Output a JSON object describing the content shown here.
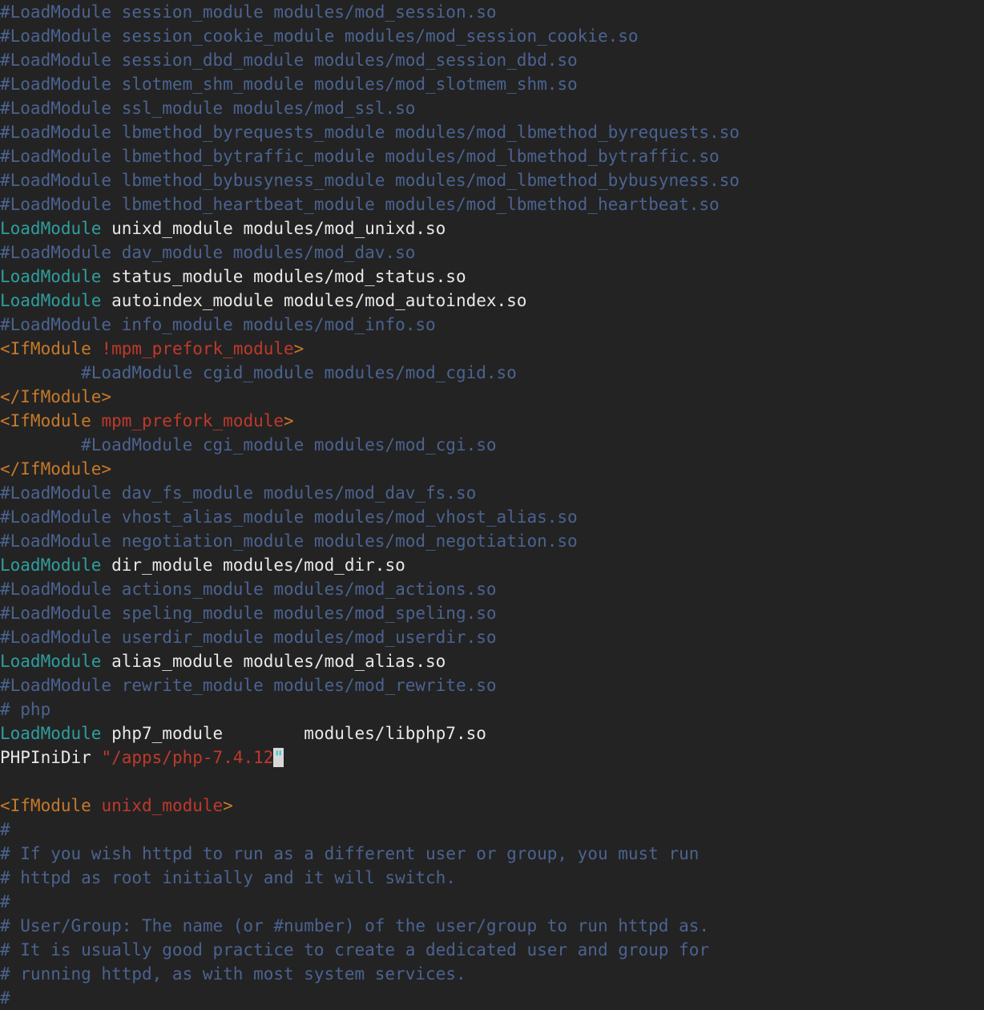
{
  "app": {
    "name": "text-editor",
    "file_type": "apache-httpd-config",
    "background_color": "#232323"
  },
  "colors": {
    "background": "#232323",
    "comment": "#4b6391",
    "directive": "#2f9e9e",
    "argument": "#e8e8e8",
    "tag": "#c8792a",
    "tag_argument": "#c0392b",
    "string": "#c0392b",
    "cursor_background": "#d8d8d8",
    "cursor_foreground": "#25c4d4"
  },
  "cursor": {
    "line_index": 30,
    "character": "\"",
    "column": 28
  },
  "lines": [
    {
      "tokens": [
        {
          "t": "#LoadModule session_module modules/mod_session.so",
          "c": "comment"
        }
      ]
    },
    {
      "tokens": [
        {
          "t": "#LoadModule session_cookie_module modules/mod_session_cookie.so",
          "c": "comment"
        }
      ]
    },
    {
      "tokens": [
        {
          "t": "#LoadModule session_dbd_module modules/mod_session_dbd.so",
          "c": "comment"
        }
      ]
    },
    {
      "tokens": [
        {
          "t": "#LoadModule slotmem_shm_module modules/mod_slotmem_shm.so",
          "c": "comment"
        }
      ]
    },
    {
      "tokens": [
        {
          "t": "#LoadModule ssl_module modules/mod_ssl.so",
          "c": "comment"
        }
      ]
    },
    {
      "tokens": [
        {
          "t": "#LoadModule lbmethod_byrequests_module modules/mod_lbmethod_byrequests.so",
          "c": "comment"
        }
      ]
    },
    {
      "tokens": [
        {
          "t": "#LoadModule lbmethod_bytraffic_module modules/mod_lbmethod_bytraffic.so",
          "c": "comment"
        }
      ]
    },
    {
      "tokens": [
        {
          "t": "#LoadModule lbmethod_bybusyness_module modules/mod_lbmethod_bybusyness.so",
          "c": "comment"
        }
      ]
    },
    {
      "tokens": [
        {
          "t": "#LoadModule lbmethod_heartbeat_module modules/mod_lbmethod_heartbeat.so",
          "c": "comment"
        }
      ]
    },
    {
      "tokens": [
        {
          "t": "LoadModule",
          "c": "directive"
        },
        {
          "t": " unixd_module modules/mod_unixd.so",
          "c": "arg"
        }
      ]
    },
    {
      "tokens": [
        {
          "t": "#LoadModule dav_module modules/mod_dav.so",
          "c": "comment"
        }
      ]
    },
    {
      "tokens": [
        {
          "t": "LoadModule",
          "c": "directive"
        },
        {
          "t": " status_module modules/mod_status.so",
          "c": "arg"
        }
      ]
    },
    {
      "tokens": [
        {
          "t": "LoadModule",
          "c": "directive"
        },
        {
          "t": " autoindex_module modules/mod_autoindex.so",
          "c": "arg"
        }
      ]
    },
    {
      "tokens": [
        {
          "t": "#LoadModule info_module modules/mod_info.so",
          "c": "comment"
        }
      ]
    },
    {
      "tokens": [
        {
          "t": "<IfModule",
          "c": "tag"
        },
        {
          "t": " ",
          "c": "plain"
        },
        {
          "t": "!mpm_prefork_module",
          "c": "tagarg"
        },
        {
          "t": ">",
          "c": "tag"
        }
      ]
    },
    {
      "tokens": [
        {
          "t": "        #LoadModule cgid_module modules/mod_cgid.so",
          "c": "comment"
        }
      ]
    },
    {
      "tokens": [
        {
          "t": "</IfModule>",
          "c": "tag"
        }
      ]
    },
    {
      "tokens": [
        {
          "t": "<IfModule",
          "c": "tag"
        },
        {
          "t": " ",
          "c": "plain"
        },
        {
          "t": "mpm_prefork_module",
          "c": "tagarg"
        },
        {
          "t": ">",
          "c": "tag"
        }
      ]
    },
    {
      "tokens": [
        {
          "t": "        #LoadModule cgi_module modules/mod_cgi.so",
          "c": "comment"
        }
      ]
    },
    {
      "tokens": [
        {
          "t": "</IfModule>",
          "c": "tag"
        }
      ]
    },
    {
      "tokens": [
        {
          "t": "#LoadModule dav_fs_module modules/mod_dav_fs.so",
          "c": "comment"
        }
      ]
    },
    {
      "tokens": [
        {
          "t": "#LoadModule vhost_alias_module modules/mod_vhost_alias.so",
          "c": "comment"
        }
      ]
    },
    {
      "tokens": [
        {
          "t": "#LoadModule negotiation_module modules/mod_negotiation.so",
          "c": "comment"
        }
      ]
    },
    {
      "tokens": [
        {
          "t": "LoadModule",
          "c": "directive"
        },
        {
          "t": " dir_module modules/mod_dir.so",
          "c": "arg"
        }
      ]
    },
    {
      "tokens": [
        {
          "t": "#LoadModule actions_module modules/mod_actions.so",
          "c": "comment"
        }
      ]
    },
    {
      "tokens": [
        {
          "t": "#LoadModule speling_module modules/mod_speling.so",
          "c": "comment"
        }
      ]
    },
    {
      "tokens": [
        {
          "t": "#LoadModule userdir_module modules/mod_userdir.so",
          "c": "comment"
        }
      ]
    },
    {
      "tokens": [
        {
          "t": "LoadModule",
          "c": "directive"
        },
        {
          "t": " alias_module modules/mod_alias.so",
          "c": "arg"
        }
      ]
    },
    {
      "tokens": [
        {
          "t": "#LoadModule rewrite_module modules/mod_rewrite.so",
          "c": "comment"
        }
      ]
    },
    {
      "tokens": [
        {
          "t": "# php",
          "c": "comment"
        }
      ]
    },
    {
      "tokens": [
        {
          "t": "LoadModule",
          "c": "directive"
        },
        {
          "t": " php7_module        modules/libphp7.so",
          "c": "arg"
        }
      ]
    },
    {
      "tokens": [
        {
          "t": "PHPIniDir",
          "c": "plain"
        },
        {
          "t": " ",
          "c": "plain"
        },
        {
          "t": "\"/apps/php-7.4.12",
          "c": "string"
        },
        {
          "t": "\"",
          "c": "cursor"
        }
      ]
    },
    {
      "tokens": [
        {
          "t": "",
          "c": "plain"
        }
      ]
    },
    {
      "tokens": [
        {
          "t": "<IfModule",
          "c": "tag"
        },
        {
          "t": " ",
          "c": "plain"
        },
        {
          "t": "unixd_module",
          "c": "tagarg"
        },
        {
          "t": ">",
          "c": "tag"
        }
      ]
    },
    {
      "tokens": [
        {
          "t": "#",
          "c": "comment"
        }
      ]
    },
    {
      "tokens": [
        {
          "t": "# If you wish httpd to run as a different user or group, you must run",
          "c": "comment"
        }
      ]
    },
    {
      "tokens": [
        {
          "t": "# httpd as root initially and it will switch.",
          "c": "comment"
        }
      ]
    },
    {
      "tokens": [
        {
          "t": "#",
          "c": "comment"
        }
      ]
    },
    {
      "tokens": [
        {
          "t": "# User/Group: The name (or #number) of the user/group to run httpd as.",
          "c": "comment"
        }
      ]
    },
    {
      "tokens": [
        {
          "t": "# It is usually good practice to create a dedicated user and group for",
          "c": "comment"
        }
      ]
    },
    {
      "tokens": [
        {
          "t": "# running httpd, as with most system services.",
          "c": "comment"
        }
      ]
    },
    {
      "tokens": [
        {
          "t": "#",
          "c": "comment"
        }
      ]
    }
  ]
}
